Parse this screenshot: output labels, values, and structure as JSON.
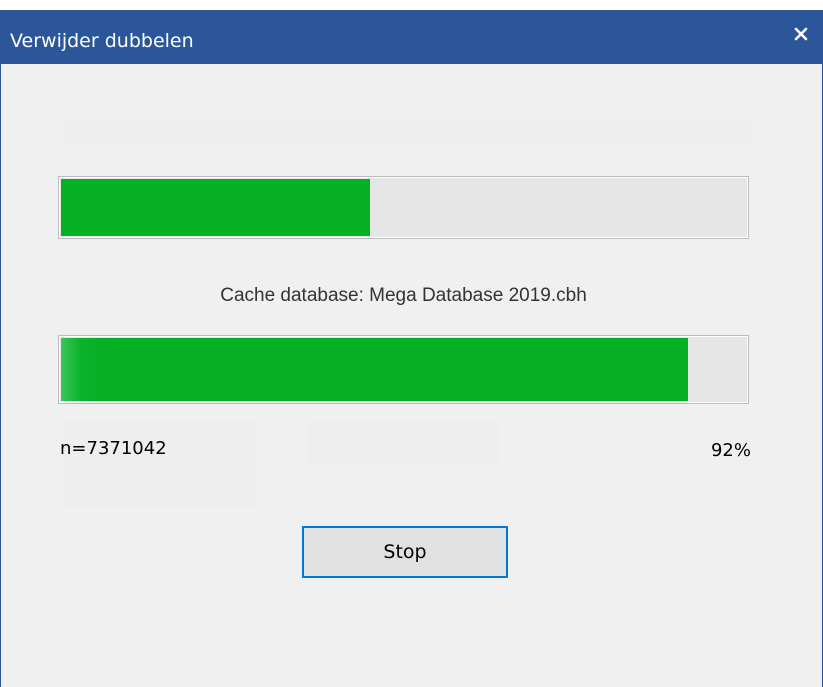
{
  "window": {
    "title": "Verwijder dubbelen",
    "close_label": "Close"
  },
  "progress_overall": {
    "value": 0.45
  },
  "status": {
    "text": "Cache database: Mega Database 2019.cbh"
  },
  "progress_current": {
    "value": 0.92
  },
  "counter": {
    "text": "n=7371042"
  },
  "percent": {
    "text": "92%"
  },
  "buttons": {
    "stop_label": "Stop"
  },
  "colors": {
    "titlebar": "#2b579a",
    "progress_fill": "#06b025",
    "button_focus_border": "#0078d7",
    "dialog_background": "#f0f0f0"
  },
  "icons": {
    "close": "close-icon"
  }
}
